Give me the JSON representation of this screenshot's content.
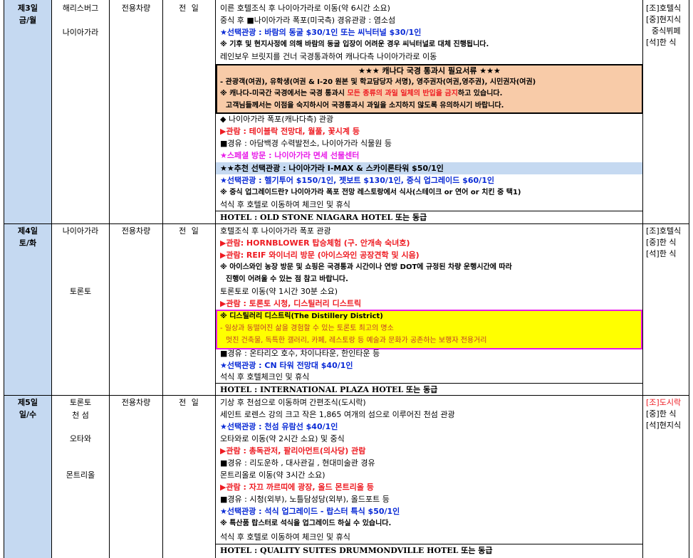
{
  "days": [
    {
      "day": "제3일",
      "weekday": "금/월",
      "cities": [
        "해리스버그",
        "나이아가라"
      ],
      "transport": "전용차량",
      "meal_plan": "전 일",
      "lines": [
        "이른 호텔조식 후 나이아가라로 이동(약 6시간 소요)",
        "중식 후 ■나이아가라 폭포(미국측) 경유관광 : 염소섬",
        "★선택관광 : 바람의 동굴 $30/1인 또는 씨닉터널 $30/1인",
        "※ 기후 및 현지사정에 의해 바람의 동굴 입장이 어려운 경우 씨닉터널로 대체 진행됩니다.",
        "레인보우 브릿지를 건너 국경통과하여 캐나다측 나이아가라로 이동"
      ],
      "notice": {
        "title": "★★★ 캐나다 국경 통과시 필요서류 ★★★",
        "items": "- 관광객(여권), 유학생(여권 & I-20 원본 및 학교담당자 서명), 영주권자(여권,영주권), 시민권자(여권)",
        "warn_prefix": "※ 캐나다-미국간 국경에서는 국경 통과시 ",
        "warn_red": "모든 종류의 과일 일체의 반입을 금지",
        "warn_suffix": "하고 있습니다.",
        "warn2": "고객님들께서는 이점을 숙지하시어 국경통과시 과일을 소지하지 않도록 유의하시기 바랍니다."
      },
      "lines2": [
        "◆ 나이아가라 폭포(캐나다측) 관광",
        "▶관람 : 테이블락 전망대, 월풀, 꽃시계 등",
        "■경유 : 아담백경 수력발전소, 나이아가라 식물원 등",
        "★스페셜 방문 : 나이아가라 면세 선물센터",
        "★★추천 선택관광 : 나이아가라 I-MAX & 스카이론타워 $50/1인",
        "★선택관광 : 헬기투어 $150/1인, 젯보트 $130/1인, 중식 업그레이드 $60/1인",
        "※ 중식 업그레이드란? 나이아가라 폭포 전망 레스토랑에서 식사(스테이크 or 연어 or 치킨 중 택1)",
        "석식 후 호텔로 이동하여 체크인 및 휴식"
      ],
      "hotel": "HOTEL : OLD STONE NIAGARA HOTEL 또는 동급",
      "meals": [
        "[조]호텔식",
        "[중]현지식",
        "중식뷔페",
        "[석]한  식"
      ]
    },
    {
      "day": "제4일",
      "weekday": "토/화",
      "cities": [
        "나이아가라",
        "토론토"
      ],
      "transport": "전용차량",
      "meal_plan": "전 일",
      "lines": [
        "호텔조식 후 나이아가라 폭포 관광",
        "▶관람: HORNBLOWER 탑승체험 (구. 안개속 숙녀호)",
        "▶관람: REIF 와이너리 방문 (아이스와인 공장견학 및 시음)",
        "※ 아이스와인 농장 방문 및 쇼핑은 국경통과 시간이나 연방 DOT에 규정된 차량 운행시간에 따라",
        "진행이 어려울 수 있는 점 참고 바랍니다.",
        "토론토로 이동(약 1시간 30분 소요)",
        "▶관람 : 토론토 시청, 디스틸러리 디스트릭"
      ],
      "distillery": {
        "title": "※ 디스틸러리 디스트릭(The Distillery District)",
        "line1": "- 일상과 동떨어진 삶을 경험할 수 있는 토론토 최고의 명소",
        "line2": "멋진 건축물, 독특한 갤러리, 카페, 레스토랑 등 예술과 문화가 공존하는 보행자 전용거리"
      },
      "lines2": [
        "■경유 : 온타리오 호수, 차이나타운, 한인타운 등",
        "★선택관광 : CN 타워 전망대 $40/1인",
        "석식 후 호텔체크인 및 휴식"
      ],
      "hotel": "HOTEL : INTERNATIONAL PLAZA HOTEL 또는 동급",
      "meals": [
        "[조]호텔식",
        "[중]한  식",
        "[석]한  식"
      ]
    },
    {
      "day": "제5일",
      "weekday": "일/수",
      "cities": [
        "토론토",
        "천 섬",
        "오타와",
        "몬트리올"
      ],
      "transport": "전용차량",
      "meal_plan": "전 일",
      "lines": [
        "기상 후 천섬으로 이동하며 간편조식(도시락)",
        "세인트 로렌스 강의 크고 작은 1,865 여개의 섬으로 이루어진 천섬 관광",
        "★선택관광 : 천섬 유람선 $40/1인",
        "오타와로 이동(약 2시간 소요) 및 중식",
        "▶관람 : 총독관저, 팔리아먼트(의사당) 관람",
        "■경유 : 리도운하 , 대사관길 , 현대미술관 경유",
        "몬트리올로 이동(약 3시간 소요)",
        "▶관람 : 자끄 까르띠에 광장, 올드 몬트리올 등",
        "■경유 : 시청(외부), 노틀담성당(외부), 올드포트 등",
        "★선택관광 : 석식 업그레이드 - 랍스터 특식 $50/1인",
        "※  특산품 랍스터로 석식을 업그레이드 하실 수 있습니다.",
        "석식 후 호텔로 이동하여 체크인 및 휴식"
      ],
      "hotel": "HOTEL : QUALITY SUITES DRUMMONDVILLE HOTEL 또는 동급",
      "meals": [
        "[조]도시락",
        "[중]한  식",
        "[석]현지식"
      ]
    }
  ],
  "colors": {
    "day_bg": "#c5d9f1",
    "notice_bg": "#f8cba8",
    "highlight_bg": "#ffff00",
    "highlight_border": "#e81ce8",
    "option_blue": "#0a2bd6",
    "attraction_red": "#ee1b22",
    "special_magenta": "#e81ce8"
  }
}
